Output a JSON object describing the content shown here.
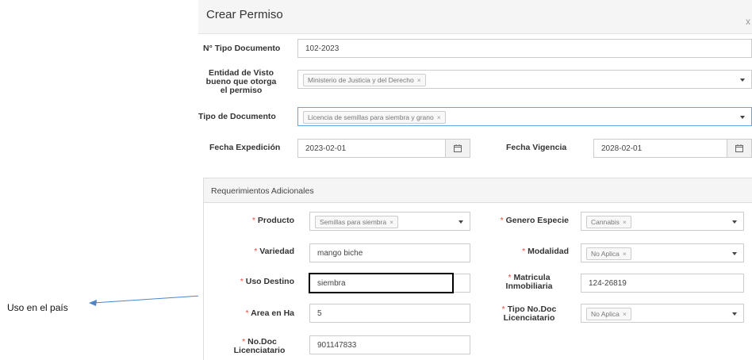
{
  "modal": {
    "title": "Crear Permiso",
    "close_label": "x"
  },
  "form": {
    "tipo_documento_label": "N° Tipo Documento",
    "tipo_documento_value": "102-2023",
    "entidad_label_1": "Entidad de Visto",
    "entidad_label_2": "bueno que otorga",
    "entidad_label_3": "el permiso",
    "entidad_value": "Ministerio de Justicia y del Derecho",
    "tipo_doc_label": "Tipo de Documento",
    "tipo_doc_value": "Licencia de semillas para siembra y grano",
    "fecha_exp_label": "Fecha Expedición",
    "fecha_exp_value": "2023-02-01",
    "fecha_vig_label": "Fecha Vigencia",
    "fecha_vig_value": "2028-02-01"
  },
  "requerimientos": {
    "title": "Requerimientos Adicionales",
    "required_marker": "*",
    "producto_label": "Producto",
    "producto_value": "Semillas para siembra",
    "genero_label": "Genero Especie",
    "genero_value": "Cannabis",
    "variedad_label": "Variedad",
    "variedad_value": "mango biche",
    "modalidad_label": "Modalidad",
    "modalidad_value": "No Aplica",
    "uso_label": "Uso Destino",
    "uso_value": "siembra",
    "matricula_label_1": "Matricula",
    "matricula_label_2": "Inmobiliaria",
    "matricula_value": "124-26819",
    "area_label": "Area en Ha",
    "area_value": "5",
    "tipo_nodoc_label_1": "Tipo No.Doc",
    "tipo_nodoc_label_2": "Licenciatario",
    "tipo_nodoc_value": "No Aplica",
    "nodoc_label_1": "No.Doc",
    "nodoc_label_2": "Licenciatario",
    "nodoc_value": "901147833"
  },
  "annotation": {
    "text": "Uso en el país",
    "highlight_color": "#000000",
    "arrow_color": "#4a86c8"
  },
  "icons": [
    "calendar-icon",
    "chevron-down-icon",
    "remove-tag-icon",
    "close-icon"
  ]
}
